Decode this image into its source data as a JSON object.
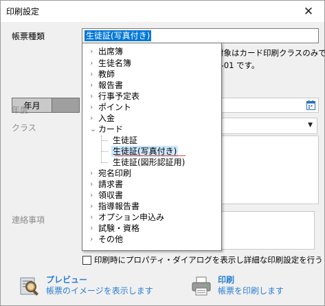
{
  "window": {
    "title": "印刷設定",
    "close_glyph": "✕"
  },
  "form": {
    "form_type_label": "帳票種類",
    "form_type_selected": "生徒証(写真付き)",
    "notice_line1": "対象はカード印刷クラスのみで",
    "notice_line2": "A-01 です。",
    "period_tab_label": "年月",
    "year_label": "年度",
    "class_label": "クラス",
    "memo_label": "連絡事項",
    "show_properties_label": "印刷時にプロパティ・ダイアログを表示し詳細な印刷設定を行う"
  },
  "actions": {
    "preview_title": "プレビュー",
    "preview_desc": "帳票のイメージを表示します",
    "print_title": "印刷",
    "print_desc": "帳票を印刷します"
  },
  "tree": {
    "items": [
      {
        "label": "出席簿",
        "expanded": false
      },
      {
        "label": "生徒名簿",
        "expanded": false
      },
      {
        "label": "教師",
        "expanded": false
      },
      {
        "label": "報告書",
        "expanded": false
      },
      {
        "label": "行事予定表",
        "expanded": false
      },
      {
        "label": "ポイント",
        "expanded": false
      },
      {
        "label": "入金",
        "expanded": false
      },
      {
        "label": "カード",
        "expanded": true
      },
      {
        "label": "宛名印刷",
        "expanded": false
      },
      {
        "label": "請求書",
        "expanded": false
      },
      {
        "label": "領収書",
        "expanded": false
      },
      {
        "label": "指導報告書",
        "expanded": false
      },
      {
        "label": "オプション申込み",
        "expanded": false
      },
      {
        "label": "試験・資格",
        "expanded": false
      },
      {
        "label": "その他",
        "expanded": false
      }
    ],
    "card_children": [
      {
        "label": "生徒証",
        "selected": false
      },
      {
        "label": "生徒証(写真付き)",
        "selected": true
      },
      {
        "label": "生徒証(図形認証用)",
        "selected": false
      }
    ]
  },
  "colors": {
    "accent": "#0078d7",
    "link": "#2a7fd4",
    "selection_highlight": "#cce8ff"
  }
}
